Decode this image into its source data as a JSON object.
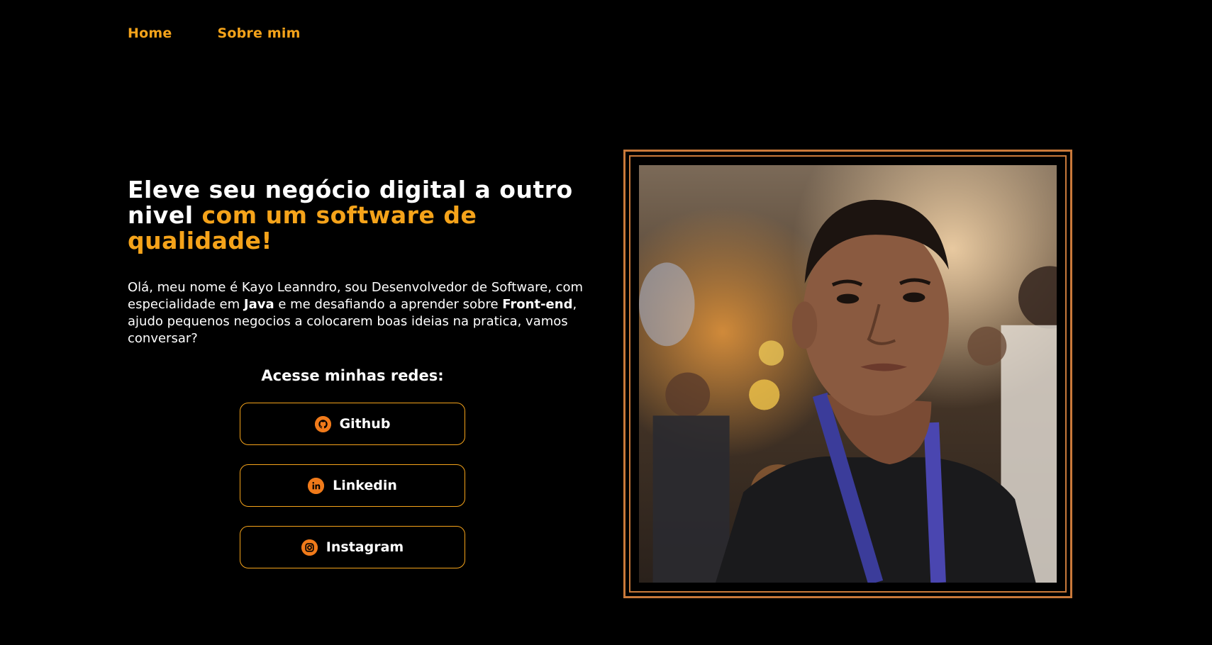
{
  "nav": {
    "items": [
      {
        "label": "Home"
      },
      {
        "label": "Sobre mim"
      }
    ]
  },
  "hero": {
    "headline_white_1": "Eleve seu negócio digital a outro nivel ",
    "headline_accent": "com um software de qualidade!",
    "intro_part1": "Olá, meu nome é Kayo Leanndro, sou Desenvolvedor de Software, com especialidade em ",
    "intro_bold1": "Java",
    "intro_part2": " e me desafiando a aprender sobre ",
    "intro_bold2": "Front-end",
    "intro_part3": ", ajudo pequenos negocios a colocarem boas ideias na pratica, vamos conversar?"
  },
  "social": {
    "title": "Acesse minhas redes:",
    "buttons": [
      {
        "label": "Github",
        "icon": "github-icon"
      },
      {
        "label": "Linkedin",
        "icon": "linkedin-icon"
      },
      {
        "label": "Instagram",
        "icon": "instagram-icon"
      }
    ]
  },
  "colors": {
    "accent": "#f5a31a",
    "icon_bg": "#f07a1a",
    "frame": "#c9793a",
    "background": "#000000"
  }
}
